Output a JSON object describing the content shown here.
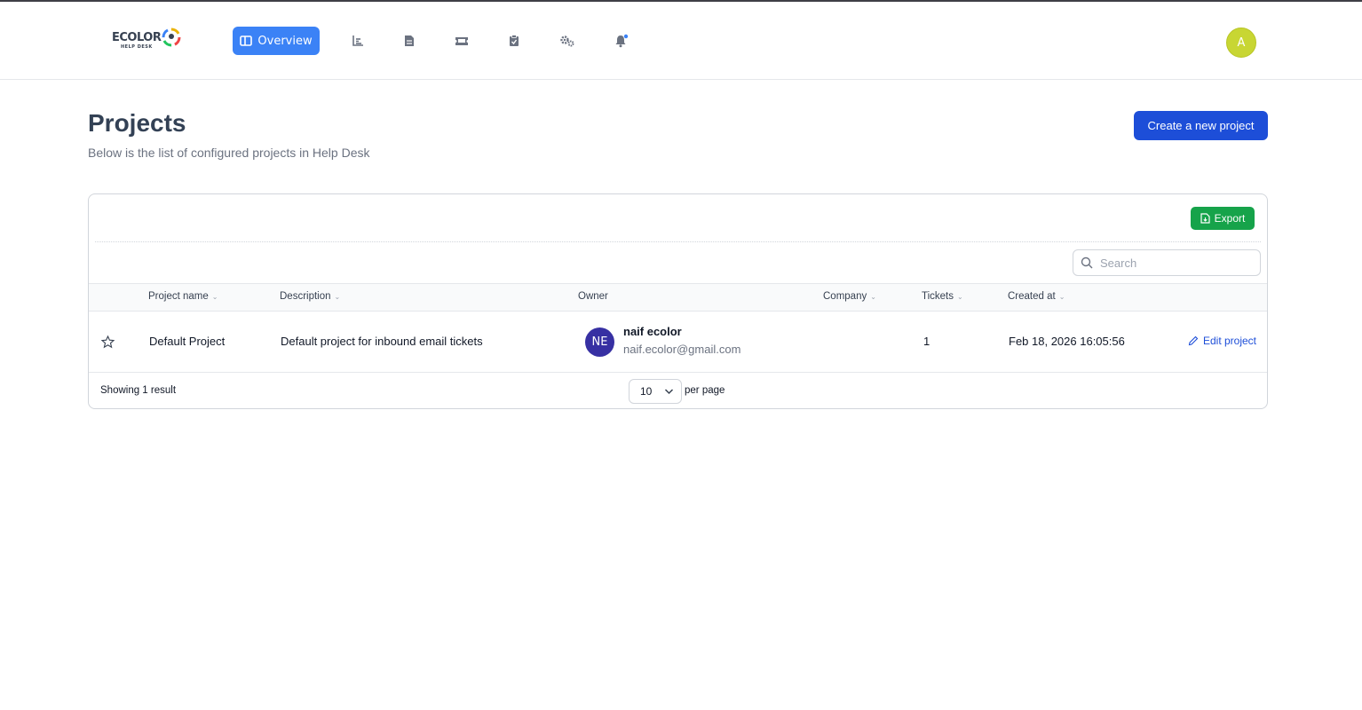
{
  "app": {
    "logo_text": "ECOLOR",
    "logo_subtext": "HELP DESK"
  },
  "nav": {
    "overview_label": "Overview",
    "items": [
      {
        "icon": "chart-bar-icon"
      },
      {
        "icon": "document-icon"
      },
      {
        "icon": "ticket-icon"
      },
      {
        "icon": "clipboard-check-icon"
      },
      {
        "icon": "cogs-icon"
      },
      {
        "icon": "bell-icon"
      }
    ],
    "user_initial": "A",
    "accent_color": "#3b82f6"
  },
  "page": {
    "title": "Projects",
    "subtitle": "Below is the list of configured projects in Help Desk",
    "create_button": "Create a new project"
  },
  "table": {
    "export_label": "Export",
    "search_placeholder": "Search",
    "columns": {
      "project_name": "Project name",
      "description": "Description",
      "owner": "Owner",
      "company": "Company",
      "tickets": "Tickets",
      "created_at": "Created at"
    },
    "rows": [
      {
        "project_name": "Default Project",
        "description": "Default project for inbound email tickets",
        "owner_initials": "NE",
        "owner_name": "naif ecolor",
        "owner_email": "naif.ecolor@gmail.com",
        "company": "",
        "tickets": "1",
        "created_at": "Feb 18, 2026 16:05:56",
        "edit_label": "Edit project"
      }
    ],
    "showing": "Showing 1 result",
    "per_page_value": "10",
    "per_page_label": "per page"
  }
}
